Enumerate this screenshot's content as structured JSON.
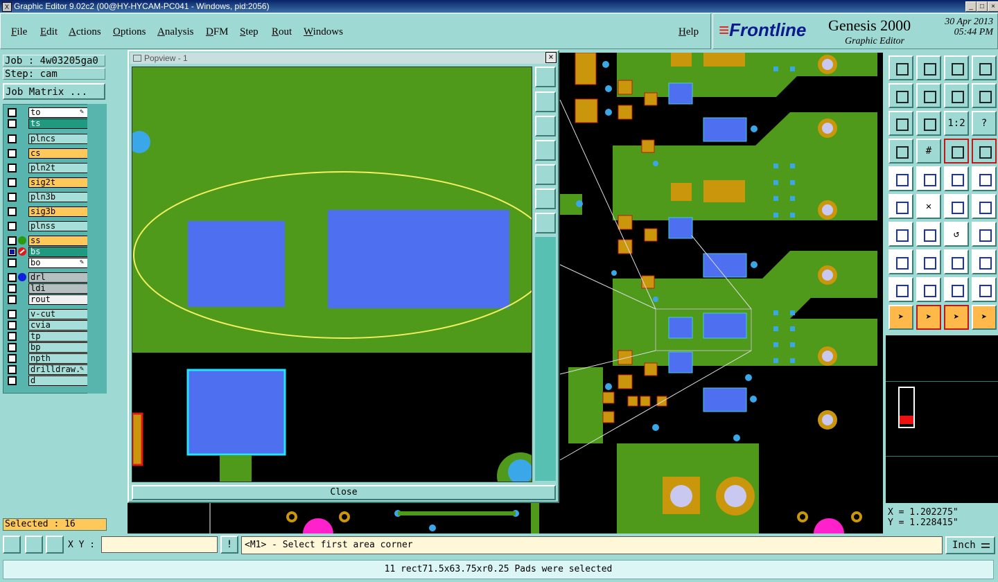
{
  "window": {
    "title": "Graphic Editor 9.02c2 (00@HY-HYCAM-PC041 - Windows, pid:2056)",
    "app_icon": "X",
    "controls": [
      "_",
      "□",
      "×"
    ]
  },
  "menubar": {
    "items": [
      "File",
      "Edit",
      "Actions",
      "Options",
      "Analysis",
      "DFM",
      "Step",
      "Rout",
      "Windows"
    ],
    "help": "Help"
  },
  "brand": {
    "logo": "Frontline",
    "product": "Genesis 2000",
    "subtitle": "Graphic Editor",
    "date": "30 Apr 2013",
    "time": "05:44 PM"
  },
  "job": {
    "job_label": "Job : 4w03205ga0",
    "step_label": "Step: cam",
    "matrix_button": "Job Matrix ..."
  },
  "layers": [
    {
      "name": "to",
      "color": "white",
      "mark": "pencil"
    },
    {
      "name": "ts",
      "color": "teal"
    },
    {
      "name": "plncs",
      "color": "lt"
    },
    {
      "name": "cs",
      "color": "or"
    },
    {
      "name": "pln2t",
      "color": "lt"
    },
    {
      "name": "sig2t",
      "color": "or"
    },
    {
      "name": "pln3b",
      "color": "lt"
    },
    {
      "name": "sig3b",
      "color": "or"
    },
    {
      "name": "plnss",
      "color": "lt"
    },
    {
      "name": "ss",
      "color": "or",
      "icon": "green-dot"
    },
    {
      "name": "bs",
      "color": "teal",
      "icon": "no-entry",
      "checked": true
    },
    {
      "name": "bo",
      "color": "white",
      "mark": "pencil"
    },
    {
      "name": "drl",
      "color": "gray",
      "icon": "blue-dot"
    },
    {
      "name": "ldi",
      "color": "gray"
    },
    {
      "name": "rout",
      "color": "wh2"
    },
    {
      "name": "v-cut",
      "color": "lt"
    },
    {
      "name": "cvia",
      "color": "lt"
    },
    {
      "name": "tp",
      "color": "lt"
    },
    {
      "name": "bp",
      "color": "lt"
    },
    {
      "name": "npth",
      "color": "lt"
    },
    {
      "name": "drilldraw.",
      "color": "lt",
      "mark": "pencil"
    },
    {
      "name": "d",
      "color": "lt"
    }
  ],
  "selected_label": "Selected : 16",
  "popview": {
    "title": "Popview - 1",
    "close_label": "Close"
  },
  "coords": {
    "x": "X = 1.202275\"",
    "y": "Y = 1.228415\""
  },
  "bottom": {
    "xy_label": "X Y :",
    "xy_value": "",
    "prompt_icon": "!",
    "message": "<M1> - Select first area corner",
    "unit": "Inch"
  },
  "status_message": "11 rect71.5x63.75xr0.25 Pads were selected",
  "colors": {
    "board_green": "#4f9a1a",
    "pad_gold": "#c9960c",
    "pad_blue": "#4d6ff0",
    "via_cyan": "#3aa8e8",
    "outline_yellow": "#f2f060"
  }
}
